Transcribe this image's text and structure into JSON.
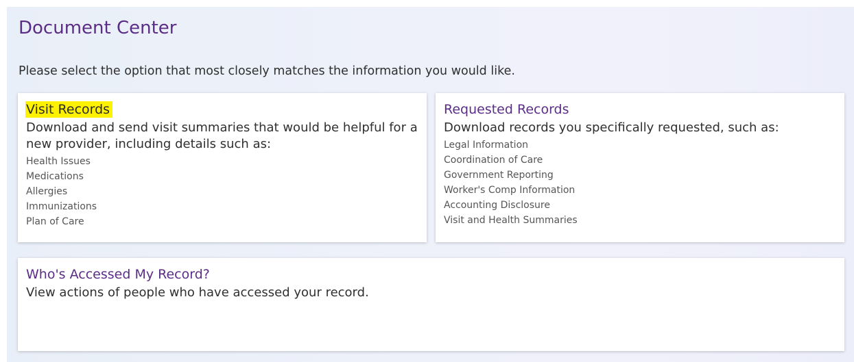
{
  "page": {
    "title": "Document Center",
    "intro": "Please select the option that most closely matches the information you would like."
  },
  "cards": {
    "visit_records": {
      "title": "Visit Records",
      "description": "Download and send visit summaries that would be helpful for a new provider, including details such as:",
      "items": [
        "Health Issues",
        "Medications",
        "Allergies",
        "Immunizations",
        "Plan of Care"
      ]
    },
    "requested_records": {
      "title": "Requested Records",
      "description": "Download records you specifically requested, such as:",
      "items": [
        "Legal Information",
        "Coordination of Care",
        "Government Reporting",
        "Worker's Comp Information",
        "Accounting Disclosure",
        "Visit and Health Summaries"
      ]
    },
    "access_log": {
      "title": "Who's Accessed My Record?",
      "description": "View actions of people who have accessed your record."
    }
  },
  "colors": {
    "accent": "#5b2d86",
    "highlight": "#fff200",
    "text": "#2f2f2f",
    "muted_text": "#555555"
  }
}
